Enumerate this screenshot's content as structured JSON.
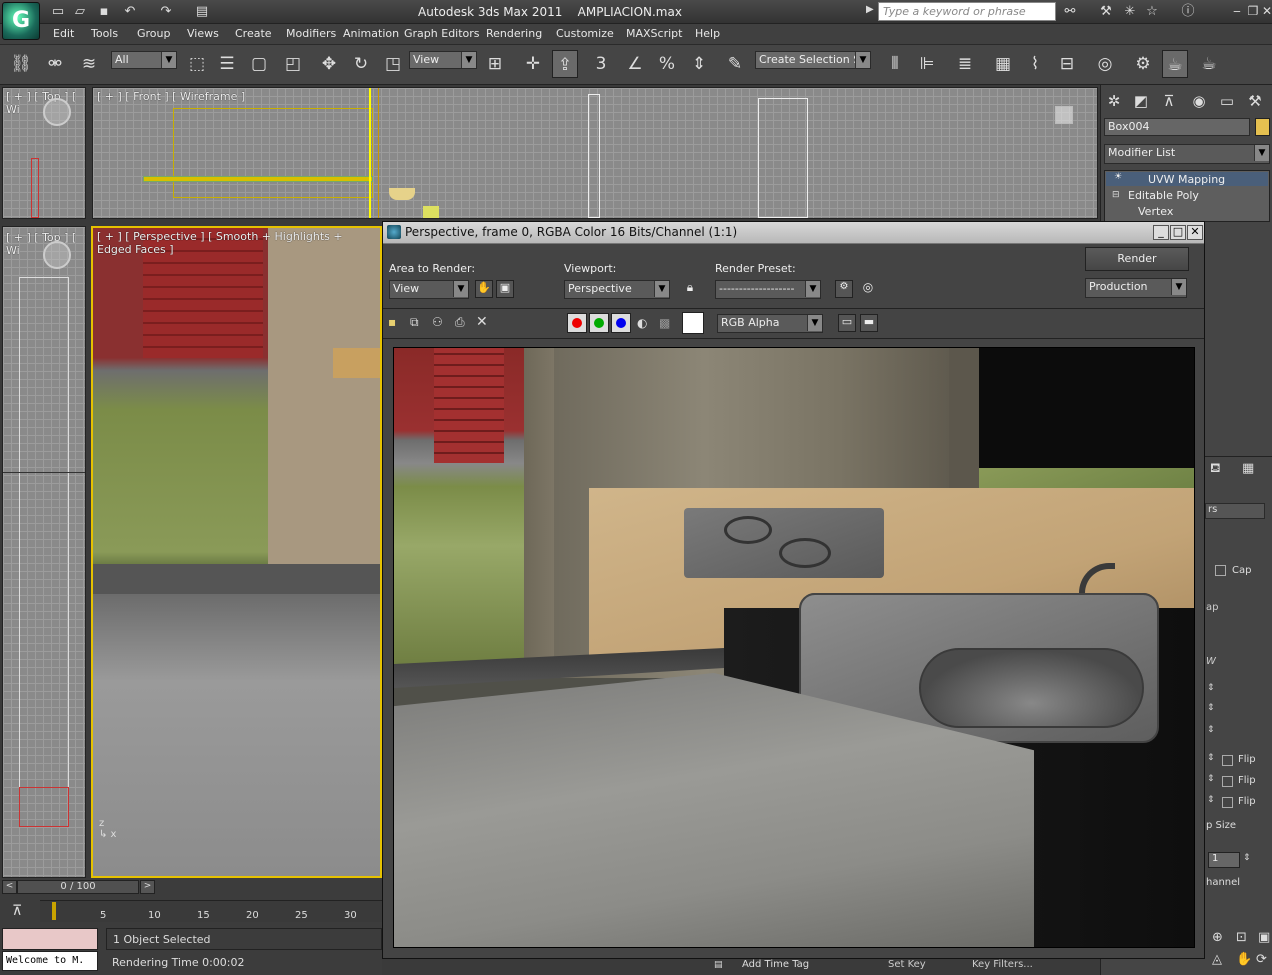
{
  "app": {
    "title": "Autodesk 3ds Max  2011",
    "filename": "AMPLIACION.max",
    "search_placeholder": "Type a keyword or phrase"
  },
  "menu": [
    "Edit",
    "Tools",
    "Group",
    "Views",
    "Create",
    "Modifiers",
    "Animation",
    "Graph Editors",
    "Rendering",
    "Customize",
    "MAXScript",
    "Help"
  ],
  "toolbar": {
    "selection_filter": "All",
    "ref_coord": "View",
    "snap_label": "3",
    "named_selection": "Create Selection Se"
  },
  "viewports": {
    "top_left_label": "[ + ] [ Top ] [ Wi",
    "front_label": "[ + ] [ Front ] [ Wireframe ]",
    "left_label": "[ + ] [ Top ] [ Wi",
    "perspective_label": "[ + ] [ Perspective ] [ Smooth + Highlights + Edged Faces ]"
  },
  "command_panel": {
    "object_name": "Box004",
    "modifier_list": "Modifier List",
    "stack": [
      "UVW Mapping",
      "Editable Poly",
      "Vertex"
    ],
    "partial_labels": [
      "rs",
      "Cap",
      "ap",
      "W",
      "Flip",
      "Flip",
      "Flip",
      "p Size",
      "1",
      "hannel"
    ]
  },
  "timeline": {
    "frame_display": "0 / 100",
    "ticks": [
      "5",
      "10",
      "15",
      "20",
      "25",
      "30"
    ]
  },
  "status": {
    "listener": "Welcome to M.",
    "selected": "1 Object Selected",
    "render_time": "Rendering Time  0:00:02",
    "add_time_tag": "Add Time Tag",
    "set_key": "Set Key",
    "key_filters": "Key Filters..."
  },
  "render_window": {
    "title": "Perspective, frame 0, RGBA Color 16 Bits/Channel (1:1)",
    "area_label": "Area to Render:",
    "area_value": "View",
    "viewport_label": "Viewport:",
    "viewport_value": "Perspective",
    "preset_label": "Render Preset:",
    "preset_value": "-------------------",
    "render_button": "Render",
    "production_value": "Production",
    "channel_value": "RGB Alpha"
  }
}
